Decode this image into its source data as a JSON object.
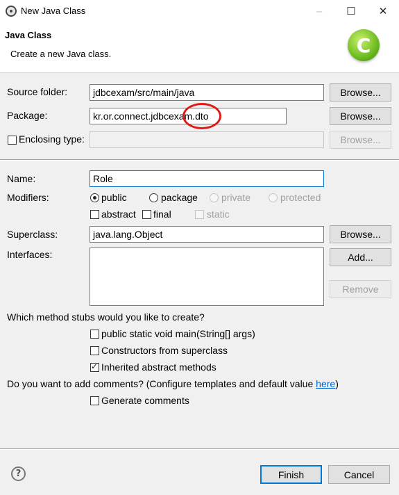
{
  "window": {
    "title": "New Java Class",
    "icons": {
      "app": "eclipse-window-icon",
      "minimize": "minimize-icon",
      "maximize": "maximize-icon",
      "close": "close-icon"
    },
    "controls": {
      "minimize": "–",
      "maximize": "☐",
      "close": "✕"
    }
  },
  "banner": {
    "title": "Java Class",
    "description": "Create a new Java class.",
    "icon": "java-class-icon",
    "icon_glyph": "C"
  },
  "form": {
    "source_folder": {
      "label": "Source folder:",
      "value": "jdbcexam/src/main/java",
      "button": "Browse..."
    },
    "package": {
      "label": "Package:",
      "value": "kr.or.connect.jdbcexam.dto",
      "button": "Browse..."
    },
    "enclosing_type": {
      "label": "Enclosing type:",
      "value": "",
      "checked": false,
      "button": "Browse..."
    },
    "name": {
      "label": "Name:",
      "value": "Role"
    },
    "modifiers": {
      "label": "Modifiers:",
      "radios": [
        {
          "label": "public",
          "checked": true,
          "enabled": true
        },
        {
          "label": "package",
          "checked": false,
          "enabled": true
        },
        {
          "label": "private",
          "checked": false,
          "enabled": false
        },
        {
          "label": "protected",
          "checked": false,
          "enabled": false
        }
      ],
      "checks": [
        {
          "label": "abstract",
          "checked": false,
          "enabled": true
        },
        {
          "label": "final",
          "checked": false,
          "enabled": true
        },
        {
          "label": "static",
          "checked": false,
          "enabled": false
        }
      ]
    },
    "superclass": {
      "label": "Superclass:",
      "value": "java.lang.Object",
      "button": "Browse..."
    },
    "interfaces": {
      "label": "Interfaces:",
      "add_button": "Add...",
      "remove_button": "Remove"
    }
  },
  "stubs": {
    "question": "Which method stubs would you like to create?",
    "options": [
      {
        "label": "public static void main(String[] args)",
        "checked": false
      },
      {
        "label": "Constructors from superclass",
        "checked": false
      },
      {
        "label": "Inherited abstract methods",
        "checked": true
      }
    ]
  },
  "comments": {
    "question": "Do you want to add comments? (Configure templates and default value ",
    "link": "here",
    "suffix": ")",
    "option": {
      "label": "Generate comments",
      "checked": false
    }
  },
  "footer": {
    "help_icon": "help-icon",
    "help_glyph": "?",
    "finish": "Finish",
    "cancel": "Cancel"
  },
  "colors": {
    "accent": "#0078d7",
    "annotation": "#e01818",
    "link": "#0066cc"
  }
}
